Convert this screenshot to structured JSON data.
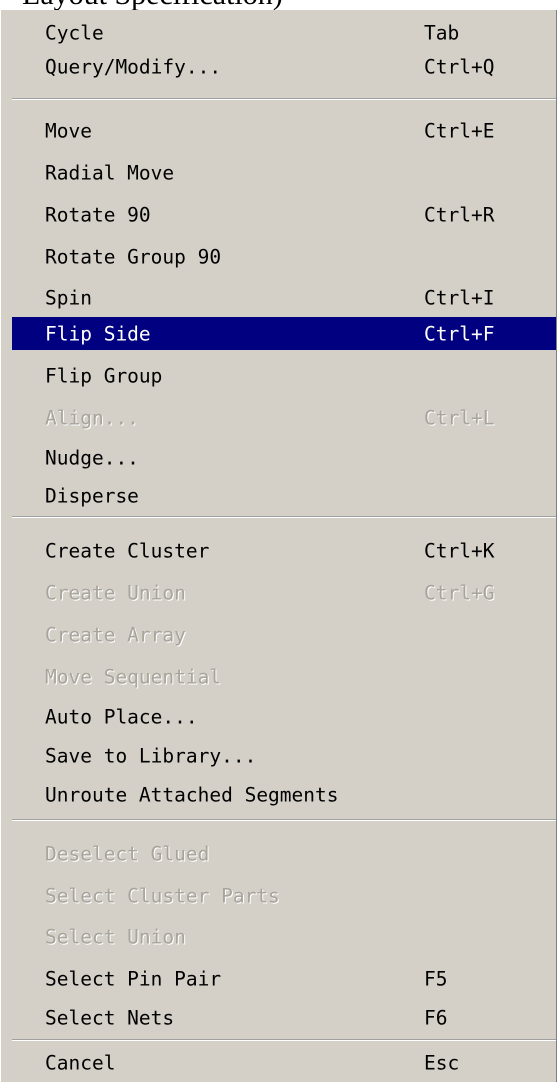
{
  "context_menu": {
    "partial_top_text": "Layout Specification)",
    "items": [
      {
        "label": "Cycle",
        "shortcut": "Tab"
      },
      {
        "label": "Query/Modify...",
        "shortcut": "Ctrl+Q"
      },
      {
        "label": "Move",
        "shortcut": "Ctrl+E"
      },
      {
        "label": "Radial Move",
        "shortcut": ""
      },
      {
        "label": "Rotate 90",
        "shortcut": "Ctrl+R"
      },
      {
        "label": "Rotate Group 90",
        "shortcut": ""
      },
      {
        "label": "Spin",
        "shortcut": "Ctrl+I"
      },
      {
        "label": "Flip Side",
        "shortcut": "Ctrl+F",
        "selected": true
      },
      {
        "label": "Flip Group",
        "shortcut": ""
      },
      {
        "label": "Align...",
        "shortcut": "Ctrl+L",
        "disabled": true
      },
      {
        "label": "Nudge...",
        "shortcut": ""
      },
      {
        "label": "Disperse",
        "shortcut": ""
      },
      {
        "label": "Create Cluster",
        "shortcut": "Ctrl+K"
      },
      {
        "label": "Create Union",
        "shortcut": "Ctrl+G",
        "disabled": true
      },
      {
        "label": "Create Array",
        "shortcut": "",
        "disabled": true
      },
      {
        "label": "Move Sequential",
        "shortcut": "",
        "disabled": true
      },
      {
        "label": "Auto Place...",
        "shortcut": ""
      },
      {
        "label": "Save to Library...",
        "shortcut": ""
      },
      {
        "label": "Unroute Attached Segments",
        "shortcut": ""
      },
      {
        "label": "Deselect Glued",
        "shortcut": "",
        "disabled": true
      },
      {
        "label": "Select Cluster Parts",
        "shortcut": "",
        "disabled": true
      },
      {
        "label": "Select Union",
        "shortcut": "",
        "disabled": true
      },
      {
        "label": "Select Pin Pair",
        "shortcut": "F5"
      },
      {
        "label": "Select Nets",
        "shortcut": "F6"
      },
      {
        "label": "Cancel",
        "shortcut": "Esc"
      }
    ],
    "colors": {
      "menu_background": "#d4d0c8",
      "highlight": "#000080",
      "disabled_text": "#a8a49c"
    }
  }
}
